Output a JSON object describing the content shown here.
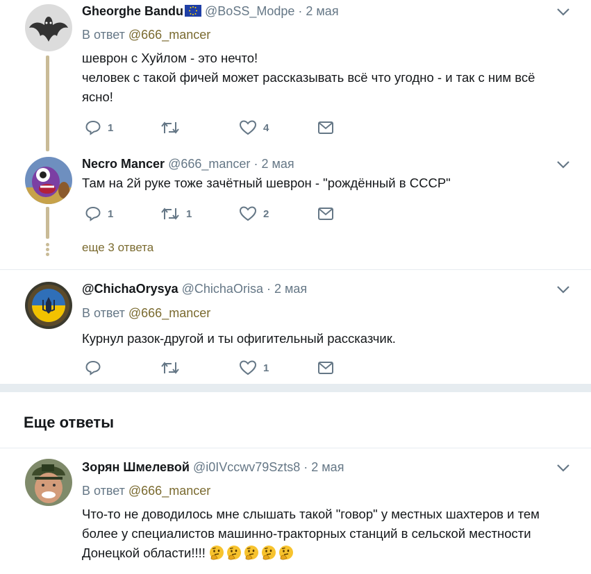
{
  "tweets": [
    {
      "name": "Gheorghe Bandu",
      "handle": "@BoSS_Modpe",
      "date": "2 мая",
      "reply_prefix": "В ответ ",
      "reply_mention": "@666_mancer",
      "text": "шеврон с Хуйлом - это нечто!\nчеловек с такой фичей может рассказывать всё что угодно - и так с ним всё ясно!",
      "replies": "1",
      "retweets": "",
      "likes": "4",
      "avatar": "bat-avatar",
      "colors": {
        "bg": "#d8d8d8",
        "fg": "#3a3a3a"
      }
    },
    {
      "name": "Necro Mancer",
      "handle": "@666_mancer",
      "date": "2 мая",
      "text": "Там на 2й руке тоже зачётный шеврон - \"рождённый в СССР\"",
      "replies": "1",
      "retweets": "1",
      "likes": "2",
      "avatar": "monster-avatar",
      "colors": {
        "bg": "#6e8fbf",
        "fg": "#7b3fa3"
      }
    },
    {
      "name": "@ChichaOrysya",
      "handle": "@ChichaOrisa",
      "date": "2 мая",
      "reply_prefix": "В ответ ",
      "reply_mention": "@666_mancer",
      "text": "Курнул разок-другой и ты офигительный рассказчик.",
      "replies": "",
      "retweets": "",
      "likes": "1",
      "avatar": "ukraine-emblem-avatar",
      "colors": {
        "bg": "#2c3e50",
        "fg": "#f2c200"
      }
    },
    {
      "name": "Зорян Шмелевой",
      "handle": "@i0IVccwv79Szts8",
      "date": "2 мая",
      "reply_prefix": "В ответ ",
      "reply_mention": "@666_mancer",
      "text": "Что-то не доводилось мне слышать такой \"говор\" у местных шахтеров и тем более у специалистов машинно-тракторных станций в сельской местности Донецкой области!!!!",
      "emoji_count": 5,
      "avatar": "man-in-cap-avatar",
      "colors": {
        "bg": "#8a7b5a",
        "fg": "#c98e6b"
      }
    }
  ],
  "more_replies_link": "еще 3 ответа",
  "section_title": "Еще ответы",
  "separator": "·",
  "icons": [
    "reply-icon",
    "retweet-icon",
    "like-icon",
    "message-icon",
    "chevron-down-icon",
    "eu-flag-icon",
    "thinking-emoji-icon"
  ],
  "accent_color": "#7a6a2f"
}
